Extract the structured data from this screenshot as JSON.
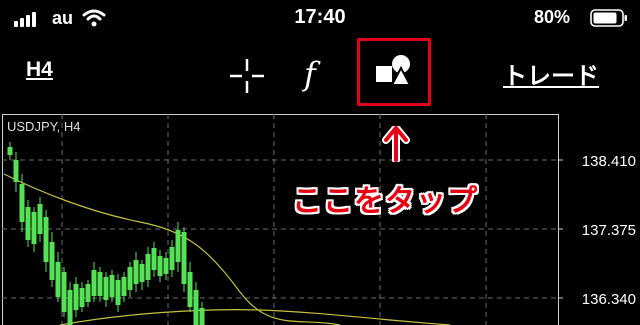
{
  "status_bar": {
    "carrier": "au",
    "time": "17:40",
    "battery": "80%",
    "icons": [
      "signal-icon",
      "wifi-icon",
      "battery-icon"
    ]
  },
  "toolbar": {
    "timeframe": "H4",
    "crosshair_icon": "crosshair-icon",
    "indicator_symbol": "f",
    "objects_icon": "shapes-icon",
    "trade": "トレード"
  },
  "chart": {
    "symbol": "USDJPY, H4",
    "price_labels": [
      "138.410",
      "137.375",
      "136.340"
    ],
    "candle_color": "#55e055",
    "ma_color": "#c8c040"
  },
  "annotation": {
    "text": "ここをタップ",
    "color": "#e60012",
    "icon": "arrow-up-icon"
  }
}
